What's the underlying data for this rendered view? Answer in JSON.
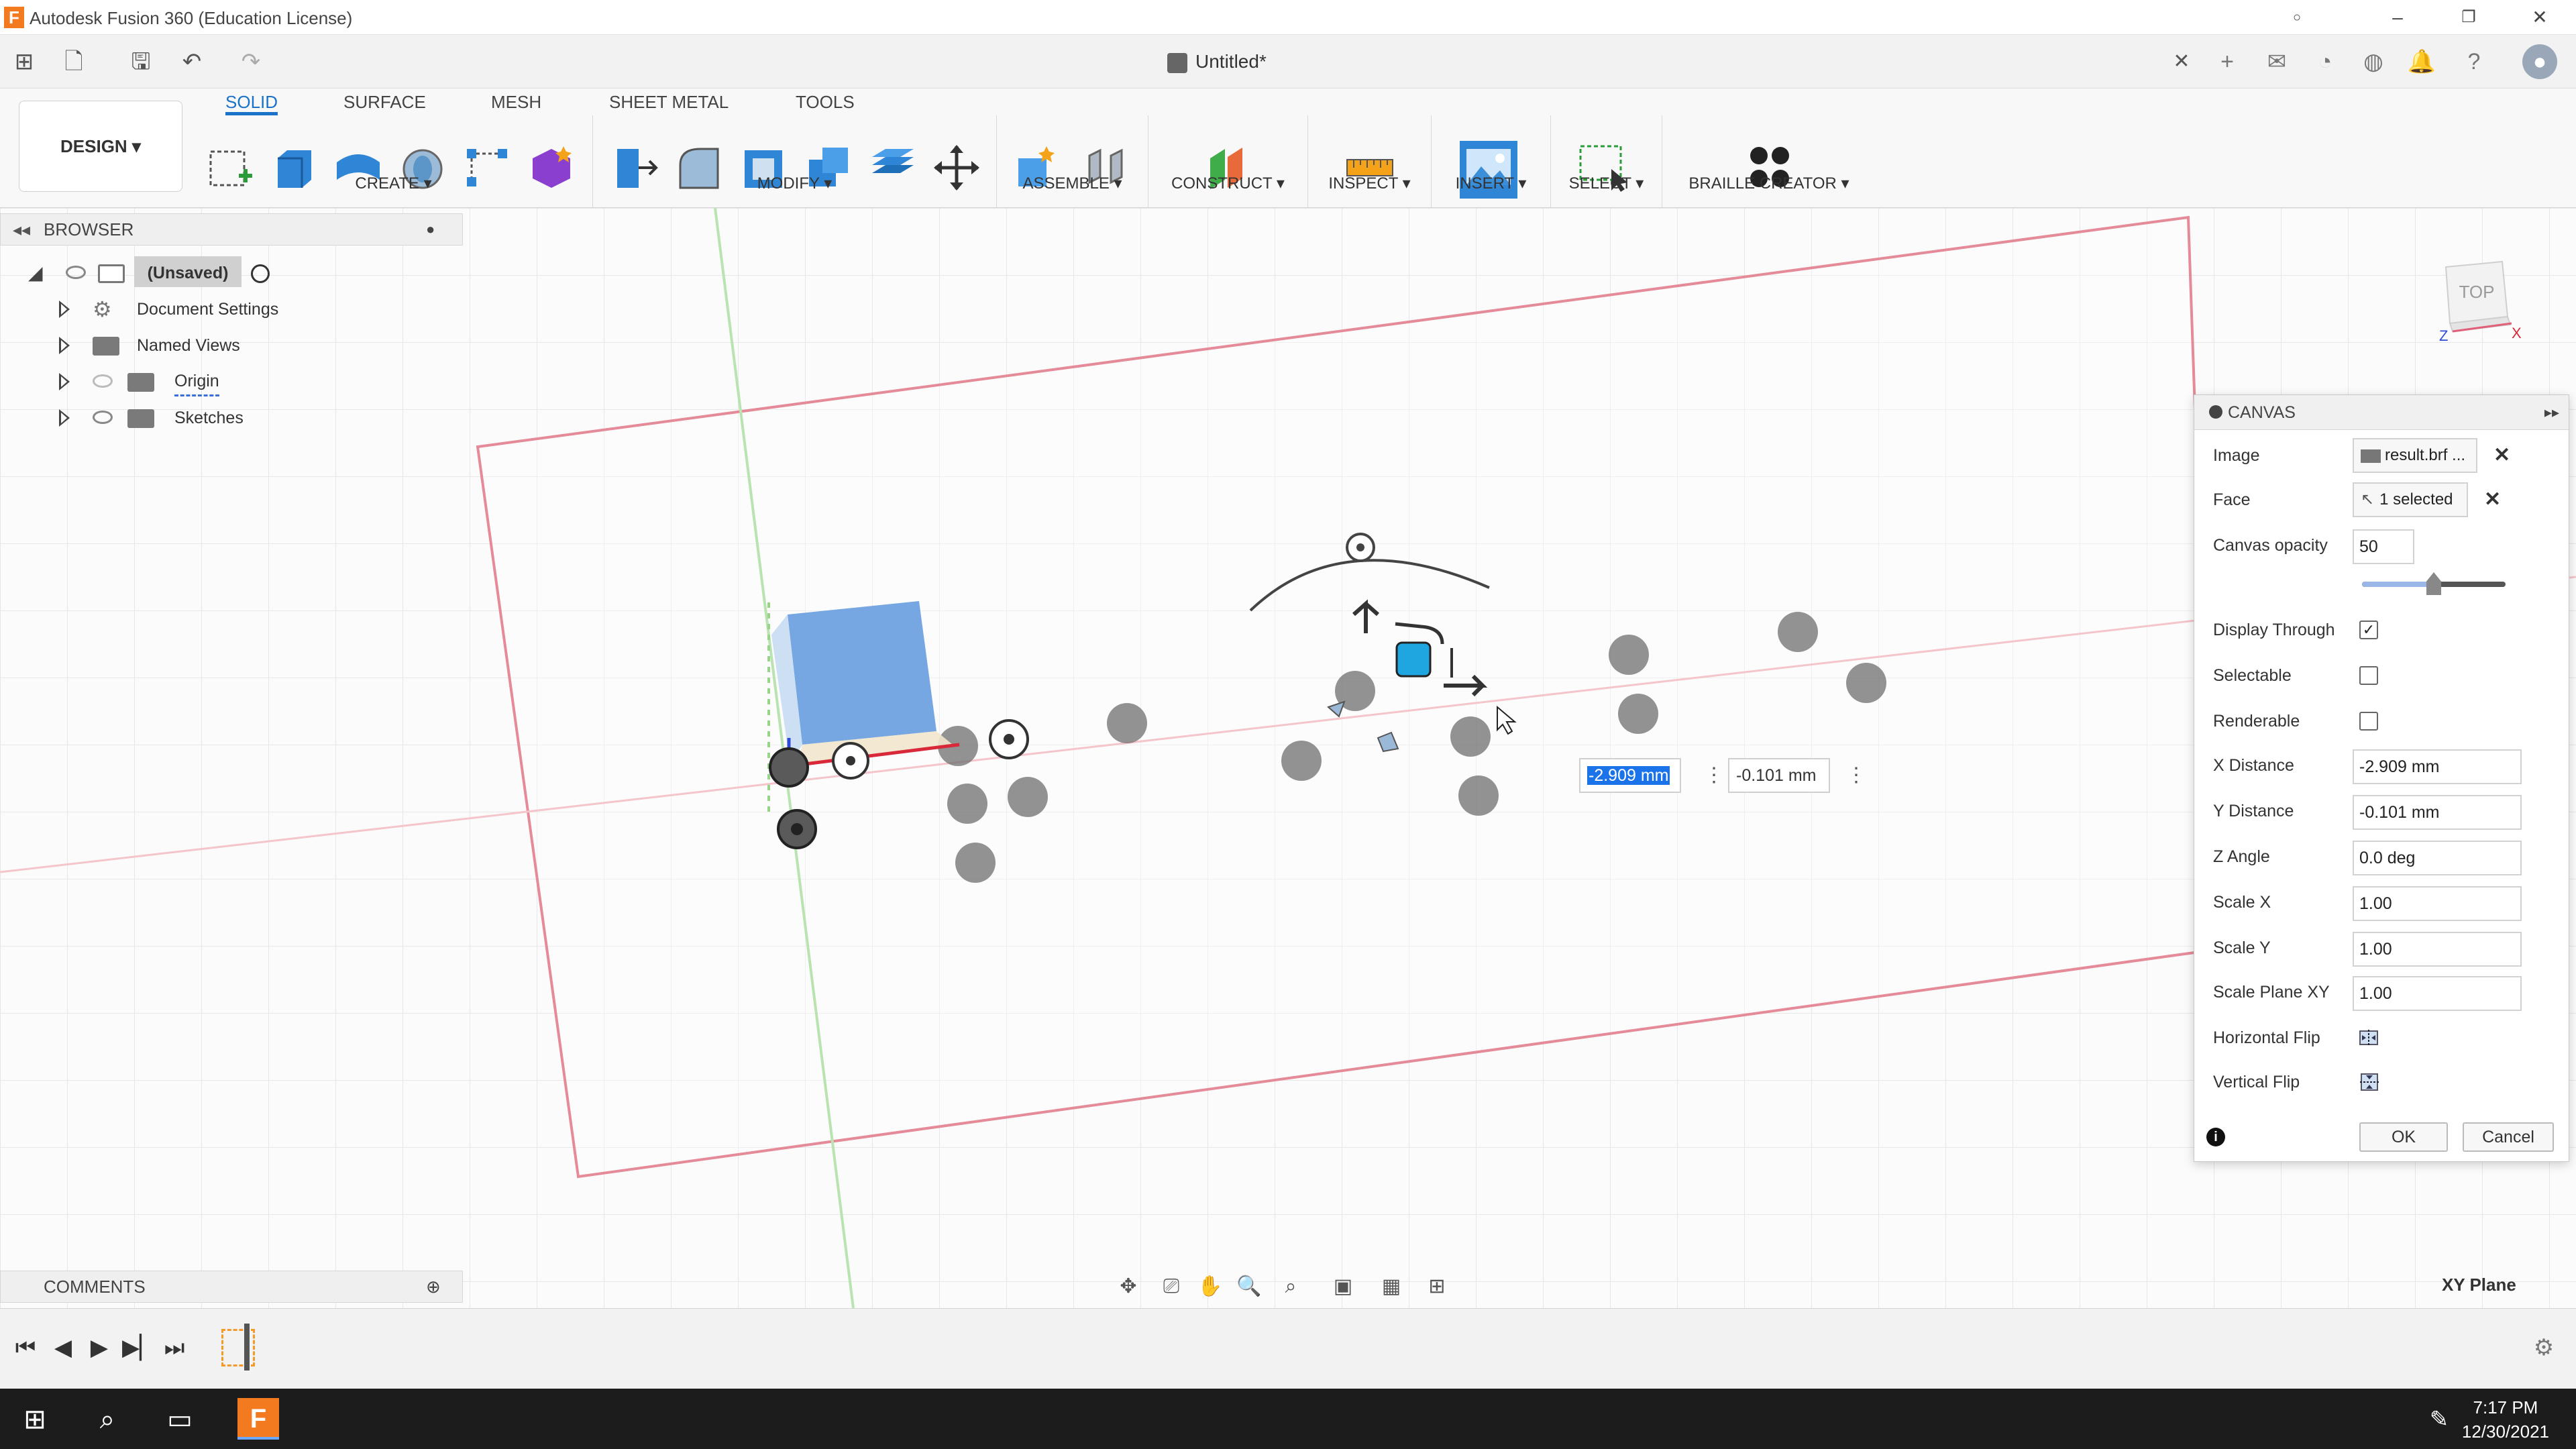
{
  "window": {
    "title": "Autodesk Fusion 360 (Education License)",
    "app_logo": "F",
    "document_tab": "Untitled*"
  },
  "ribbon": {
    "design_label": "DESIGN ▾",
    "tabs": [
      "SOLID",
      "SURFACE",
      "MESH",
      "SHEET METAL",
      "TOOLS"
    ],
    "groups": [
      "CREATE ▾",
      "MODIFY ▾",
      "ASSEMBLE ▾",
      "CONSTRUCT ▾",
      "INSPECT ▾",
      "INSERT ▾",
      "SELECT ▾",
      "BRAILLE CREATOR ▾"
    ]
  },
  "browser": {
    "title": "BROWSER",
    "root": "(Unsaved)",
    "items": [
      "Document Settings",
      "Named Views",
      "Origin",
      "Sketches"
    ]
  },
  "comments": {
    "title": "COMMENTS"
  },
  "viewport": {
    "x_value_box": "-2.909 mm",
    "y_value_box": "-0.101 mm",
    "plane_label": "XY Plane",
    "viewcube_label": "TOP"
  },
  "canvas_dialog": {
    "title": "CANVAS",
    "image_label": "Image",
    "image_value": "result.brf ...",
    "face_label": "Face",
    "face_value": "1 selected",
    "opacity_label": "Canvas opacity",
    "opacity_value": "50",
    "opacity_fraction": 0.5,
    "display_through_label": "Display Through",
    "display_through": true,
    "selectable_label": "Selectable",
    "selectable": false,
    "renderable_label": "Renderable",
    "renderable": false,
    "x_distance_label": "X Distance",
    "x_distance": "-2.909 mm",
    "y_distance_label": "Y Distance",
    "y_distance": "-0.101 mm",
    "z_angle_label": "Z Angle",
    "z_angle": "0.0 deg",
    "scale_x_label": "Scale X",
    "scale_x": "1.00",
    "scale_y_label": "Scale Y",
    "scale_y": "1.00",
    "scale_plane_label": "Scale Plane XY",
    "scale_plane": "1.00",
    "hflip_label": "Horizontal Flip",
    "vflip_label": "Vertical Flip",
    "ok_label": "OK",
    "cancel_label": "Cancel"
  },
  "taskbar": {
    "time": "7:17 PM",
    "date": "12/30/2021"
  },
  "colors": {
    "accent": "#1a73c9",
    "box": "#6a9fe0",
    "sketch_line": "#e87a8a",
    "taskbar": "#1c1c1c"
  }
}
